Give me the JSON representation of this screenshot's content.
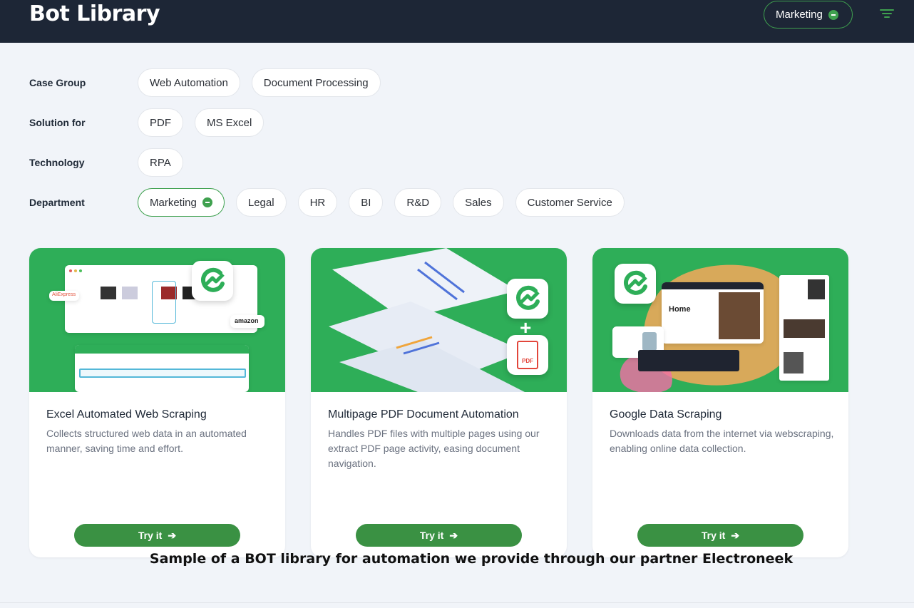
{
  "app": {
    "title": "Bot Library",
    "active_filter": "Marketing"
  },
  "filters": [
    {
      "label": "Case Group",
      "options": [
        "Web Automation",
        "Document Processing"
      ],
      "active": null
    },
    {
      "label": "Solution for",
      "options": [
        "PDF",
        "MS Excel"
      ],
      "active": null
    },
    {
      "label": "Technology",
      "options": [
        "RPA"
      ],
      "active": null
    },
    {
      "label": "Department",
      "options": [
        "Marketing",
        "Legal",
        "HR",
        "BI",
        "R&D",
        "Sales",
        "Customer Service"
      ],
      "active": "Marketing"
    }
  ],
  "cards": [
    {
      "title": "Excel Automated Web Scraping",
      "description": "Collects structured web data in an automated manner, saving time and effort.",
      "button": "Try it",
      "image_labels": {
        "brand_1": "AliExpress",
        "brand_2": "amazon"
      }
    },
    {
      "title": "Multipage PDF Document Automation",
      "description": "Handles PDF files with multiple pages using our extract PDF page activity, easing document navigation.",
      "button": "Try it",
      "image_labels": {
        "plus": "+",
        "pdf": "PDF"
      }
    },
    {
      "title": "Google Data Scraping",
      "description": "Downloads data from the internet via webscraping, enabling online data collection.",
      "button": "Try it",
      "image_labels": {
        "home": "Home"
      }
    }
  ],
  "caption": "Sample of a BOT library for automation we provide through our partner Electroneek",
  "colors": {
    "header_bg": "#1d2636",
    "accent_green": "#3fa14f",
    "button_green": "#3a9143",
    "card_image_green": "#2eae58",
    "page_bg": "#f1f4f9"
  },
  "icons": [
    "filter-icon",
    "remove-filter-icon",
    "arrow-right-icon",
    "electroneek-logo-icon",
    "pdf-file-icon"
  ]
}
